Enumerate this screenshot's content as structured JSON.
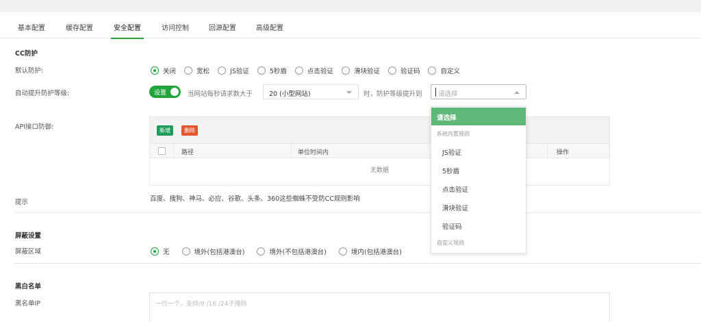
{
  "tabs": [
    {
      "label": "基本配置"
    },
    {
      "label": "缓存配置"
    },
    {
      "label": "安全配置"
    },
    {
      "label": "访问控制"
    },
    {
      "label": "回源配置"
    },
    {
      "label": "高级配置"
    }
  ],
  "colors": {
    "accent": "#20a53a",
    "selected_option_bg": "#5fb878",
    "add_button": "#1e9c5b",
    "delete_button": "#e5552c"
  },
  "cc": {
    "section_title": "CC防护",
    "default_protection": {
      "label": "默认防护:",
      "options": [
        "关闭",
        "宽松",
        "JS验证",
        "5秒盾",
        "点击验证",
        "滑块验证",
        "验证码",
        "自定义"
      ],
      "selected_index": 0
    },
    "auto_raise": {
      "label": "自动提升防护等级:",
      "toggle_label": "设置",
      "text_before": "当网站每秒请求数大于",
      "threshold_value": "20 (小型网站)",
      "text_after": "时，防护等级提升到",
      "level_placeholder": "请选择"
    },
    "level_dropdown": {
      "selected": "请选择",
      "group_builtin": "系统内置规则",
      "builtin_items": [
        "JS验证",
        "5秒盾",
        "点击验证",
        "滑块验证",
        "验证码"
      ],
      "group_custom": "自定义规则"
    },
    "api": {
      "label": "API接口防御:",
      "add_button": "新增",
      "delete_button": "删除",
      "columns": [
        "路径",
        "单位时间内",
        "操作"
      ],
      "empty_text": "无数据"
    },
    "tip": {
      "label": "提示",
      "text": "百度、搜狗、神马、必应、谷歌、头条、360这些蜘蛛不受防CC规则影响"
    }
  },
  "shield": {
    "section_title": "屏蔽设置",
    "region": {
      "label": "屏蔽区域",
      "options": [
        "无",
        "境外(包括港澳台)",
        "境外(不包括港澳台)",
        "境内(包括港澳台)"
      ],
      "selected_index": 0
    }
  },
  "blackwhite": {
    "section_title": "黑白名单",
    "blacklist_ip": {
      "label": "黑名单IP",
      "placeholder": "一行一个，支持/8 /16 /24子掩码"
    }
  }
}
